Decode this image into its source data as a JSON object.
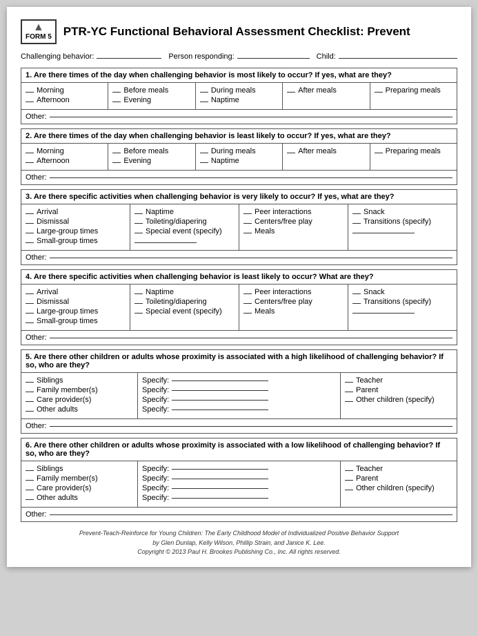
{
  "header": {
    "badge_form": "FORM",
    "badge_num": "5",
    "title": "PTR-YC Functional Behavioral Assessment Checklist: Prevent"
  },
  "top_fields": {
    "challenging_behavior": "Challenging behavior:",
    "person_responding": "Person responding:",
    "child": "Child:"
  },
  "sections": [
    {
      "id": "q1",
      "question": "1.   Are there times of the day when challenging behavior is most likely to occur? If yes, what are they?",
      "cols": [
        {
          "items": [
            "Morning",
            "Afternoon"
          ]
        },
        {
          "items": [
            "Before meals",
            "Evening"
          ]
        },
        {
          "items": [
            "During meals",
            "Naptime"
          ]
        },
        {
          "items": [
            "After meals"
          ]
        },
        {
          "items": [
            "Preparing meals"
          ]
        }
      ]
    },
    {
      "id": "q2",
      "question": "2.   Are there times of the day when challenging behavior is least likely to occur? If yes, what are they?",
      "cols": [
        {
          "items": [
            "Morning",
            "Afternoon"
          ]
        },
        {
          "items": [
            "Before meals",
            "Evening"
          ]
        },
        {
          "items": [
            "During meals",
            "Naptime"
          ]
        },
        {
          "items": [
            "After meals"
          ]
        },
        {
          "items": [
            "Preparing meals"
          ]
        }
      ]
    },
    {
      "id": "q3",
      "question": "3.   Are there specific activities when challenging behavior is very likely to occur? If yes, what are they?",
      "cols": [
        {
          "items": [
            "Arrival",
            "Dismissal",
            "Large-group times",
            "Small-group times"
          ]
        },
        {
          "items": [
            "Naptime",
            "Toileting/diapering",
            "Special event (specify)",
            "_______________"
          ]
        },
        {
          "items": [
            "Peer interactions",
            "Centers/free play",
            "Meals"
          ]
        },
        {
          "items": [
            "Snack",
            "Transitions (specify)",
            "_______________"
          ]
        }
      ]
    },
    {
      "id": "q4",
      "question": "4.   Are there specific activities when challenging behavior is least likely to occur? What are they?",
      "cols": [
        {
          "items": [
            "Arrival",
            "Dismissal",
            "Large-group times",
            "Small-group times"
          ]
        },
        {
          "items": [
            "Naptime",
            "Toileting/diapering",
            "Special event (specify)"
          ]
        },
        {
          "items": [
            "Peer interactions",
            "Centers/free play",
            "Meals"
          ]
        },
        {
          "items": [
            "Snack",
            "Transitions (specify)",
            "_______________"
          ]
        }
      ]
    },
    {
      "id": "q5",
      "question": "5.   Are there other children or adults whose proximity is associated with a high likelihood of challenging behavior? If so, who are they?",
      "cols": [
        {
          "items": [
            "Siblings",
            "Family member(s)",
            "Care provider(s)",
            "Other adults"
          ]
        },
        {
          "specify": true,
          "labels": [
            "Specify:",
            "Specify:",
            "Specify:",
            "Specify:"
          ]
        },
        {
          "items": [
            "Teacher",
            "Parent",
            "Other children (specify)"
          ]
        }
      ]
    },
    {
      "id": "q6",
      "question": "6.   Are there other children or adults whose proximity is associated with a low likelihood of challenging behavior? If so, who are they?",
      "cols": [
        {
          "items": [
            "Siblings",
            "Family member(s)",
            "Care provider(s)",
            "Other adults"
          ]
        },
        {
          "specify": true,
          "labels": [
            "Specify:",
            "Specify:",
            "Specify:",
            "Specify:"
          ]
        },
        {
          "items": [
            "Teacher",
            "Parent",
            "Other children (specify)"
          ]
        }
      ]
    }
  ],
  "other_label": "Other:",
  "footer": {
    "line1": "Prevent-Teach-Reinforce for Young Children: The Early Childhood Model of Individualized Positive Behavior Support",
    "line2": "by Glen Dunlap, Kelly Wilson, Phillip Strain, and Janice K. Lee.",
    "line3": "Copyright © 2013 Paul H. Brookes Publishing Co., Inc. All rights reserved."
  }
}
